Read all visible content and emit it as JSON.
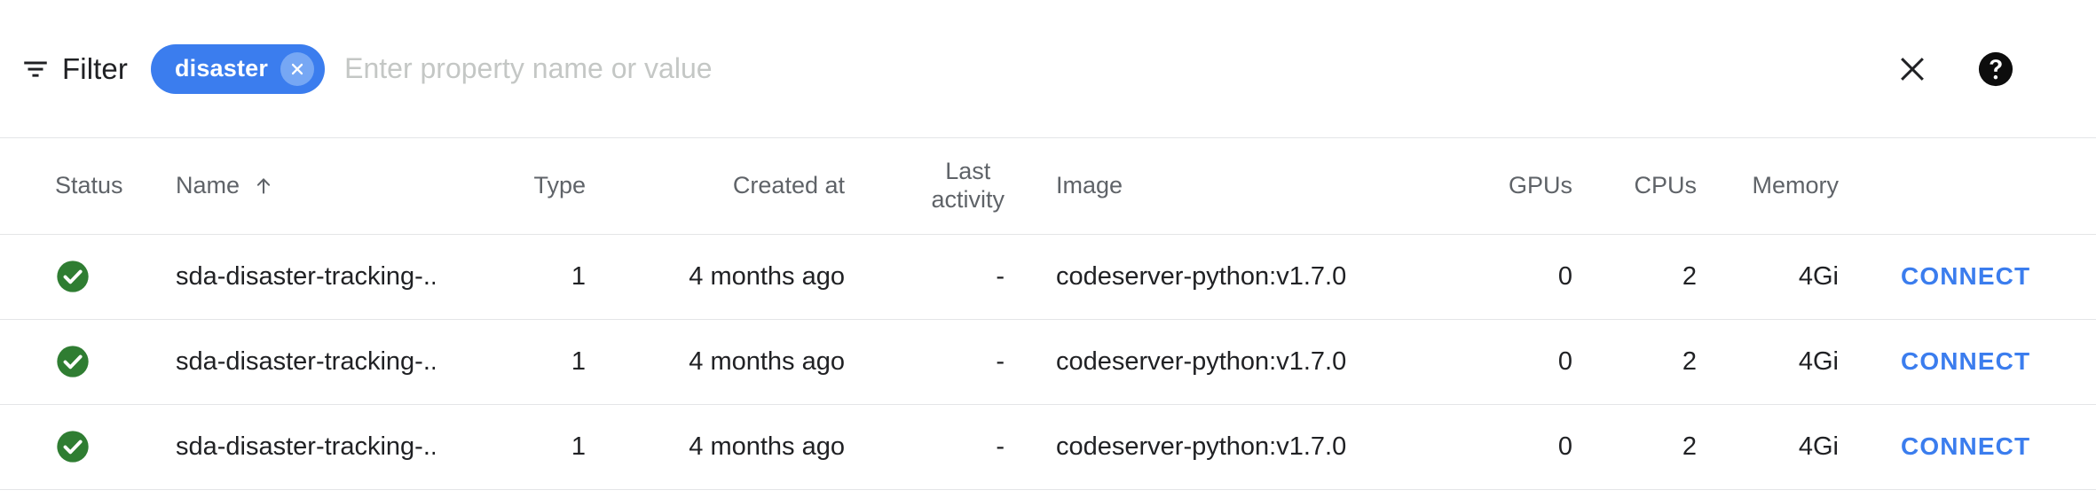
{
  "toolbar": {
    "filter_icon": "filter-list-icon",
    "filter_label": "Filter",
    "chip": {
      "label": "disaster",
      "remove_icon": "chip-close-icon",
      "bg_color": "#3b7dee",
      "remove_bg_color": "#76a7f4"
    },
    "input": {
      "value": "",
      "placeholder": "Enter property name or value"
    },
    "close_icon": "close-icon",
    "help_icon": "help-circle-icon"
  },
  "table": {
    "columns": [
      {
        "key": "status",
        "label": "Status"
      },
      {
        "key": "name",
        "label": "Name",
        "sorted": true,
        "sort_icon": "arrow-up-icon"
      },
      {
        "key": "type",
        "label": "Type"
      },
      {
        "key": "created",
        "label": "Created at"
      },
      {
        "key": "activity",
        "label_line1": "Last",
        "label_line2": "activity"
      },
      {
        "key": "image",
        "label": "Image"
      },
      {
        "key": "gpus",
        "label": "GPUs"
      },
      {
        "key": "cpus",
        "label": "CPUs"
      },
      {
        "key": "memory",
        "label": "Memory"
      },
      {
        "key": "connect",
        "label": ""
      },
      {
        "key": "stop",
        "label": ""
      },
      {
        "key": "delete",
        "label": ""
      }
    ],
    "rows": [
      {
        "status": "ok",
        "status_icon": "check-circle-icon",
        "name": "sda-disaster-tracking-...",
        "type": "1",
        "created": "4 months ago",
        "activity": "-",
        "image": "codeserver-python:v1.7.0",
        "gpus": "0",
        "cpus": "2",
        "memory": "4Gi",
        "connect_label": "CONNECT",
        "stop_icon": "stop-icon",
        "delete_icon": "trash-icon"
      },
      {
        "status": "ok",
        "status_icon": "check-circle-icon",
        "name": "sda-disaster-tracking-...",
        "type": "1",
        "created": "4 months ago",
        "activity": "-",
        "image": "codeserver-python:v1.7.0",
        "gpus": "0",
        "cpus": "2",
        "memory": "4Gi",
        "connect_label": "CONNECT",
        "stop_icon": "stop-icon",
        "delete_icon": "trash-icon"
      },
      {
        "status": "ok",
        "status_icon": "check-circle-icon",
        "name": "sda-disaster-tracking-...",
        "type": "1",
        "created": "4 months ago",
        "activity": "-",
        "image": "codeserver-python:v1.7.0",
        "gpus": "0",
        "cpus": "2",
        "memory": "4Gi",
        "connect_label": "CONNECT",
        "stop_icon": "stop-icon",
        "delete_icon": "trash-icon"
      }
    ]
  },
  "colors": {
    "accent_blue": "#3b7dee",
    "status_green": "#2f7d32",
    "header_text": "#5f6368",
    "body_text": "#202124",
    "divider": "#e4e5e7",
    "placeholder": "#c4c7c5"
  }
}
